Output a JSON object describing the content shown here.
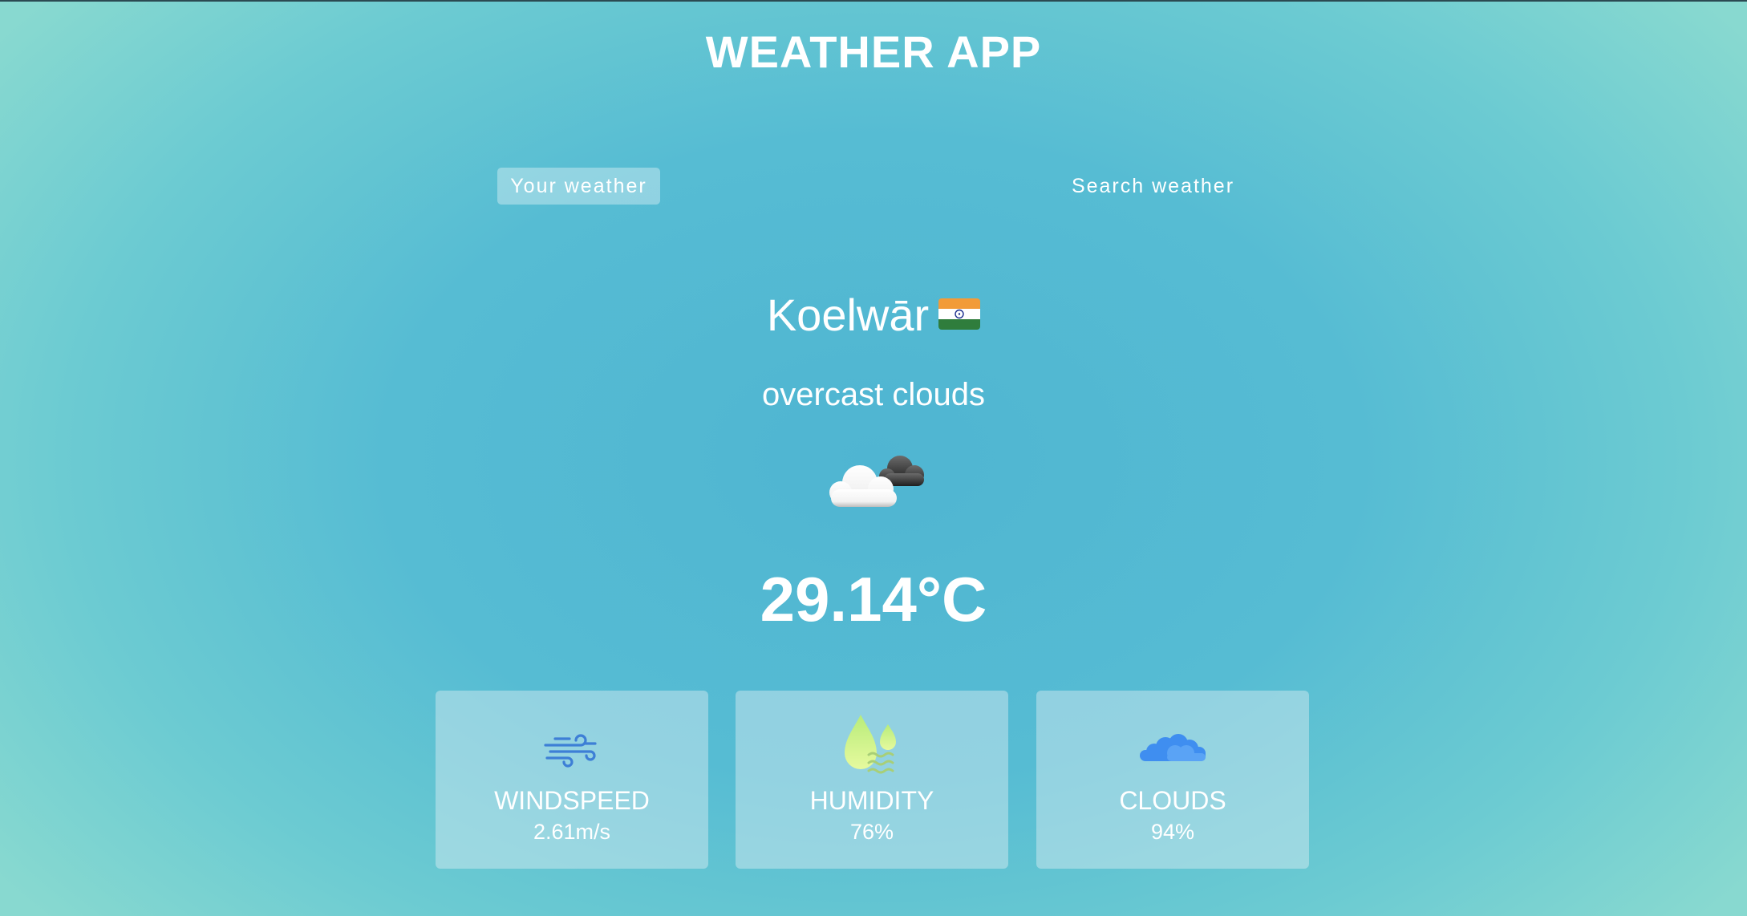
{
  "app": {
    "title": "WEATHER APP"
  },
  "tabs": [
    {
      "label": "Your weather",
      "active": true
    },
    {
      "label": "Search weather",
      "active": false
    }
  ],
  "location": {
    "city": "Koelwār",
    "flag_icon": "india-flag-icon"
  },
  "weather": {
    "description": "overcast clouds",
    "icon": "overcast-clouds-icon",
    "temperature": "29.14°C"
  },
  "stats": [
    {
      "label": "WINDSPEED",
      "value": "2.61m/s",
      "icon": "wind-icon"
    },
    {
      "label": "HUMIDITY",
      "value": "76%",
      "icon": "humidity-icon"
    },
    {
      "label": "CLOUDS",
      "value": "94%",
      "icon": "clouds-icon"
    }
  ],
  "colors": {
    "background_center": "#4fb5d2",
    "background_edge": "#88d9d0",
    "wind_icon": "#3d7fd6",
    "humidity_icon": "#d6f58a",
    "clouds_icon": "#3f8ef0"
  }
}
